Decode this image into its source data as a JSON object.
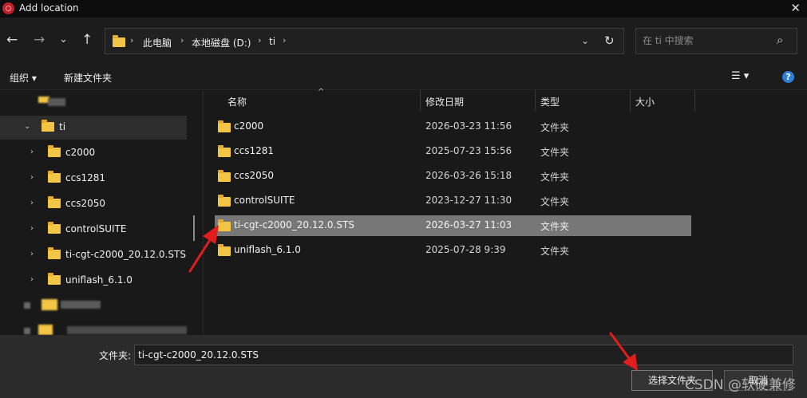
{
  "window": {
    "title": "Add location",
    "close_glyph": "✕"
  },
  "nav": {
    "back_glyph": "←",
    "forward_glyph": "→",
    "recent_glyph": "⌄",
    "up_glyph": "↑",
    "refresh_glyph": "↻"
  },
  "address": {
    "crumbs": [
      "此电脑",
      "本地磁盘 (D:)",
      "ti"
    ],
    "separator": "›"
  },
  "search": {
    "placeholder": "在 ti 中搜索",
    "icon_glyph": "⌕"
  },
  "toolbar": {
    "organize_label": "组织 ▾",
    "new_folder_label": "新建文件夹",
    "view_glyph": "☰ ▾",
    "help_glyph": "?"
  },
  "tree": {
    "root": {
      "label": "ti",
      "chevron": "⌄"
    },
    "children": [
      {
        "label": "c2000",
        "chevron": "›"
      },
      {
        "label": "ccs1281",
        "chevron": "›"
      },
      {
        "label": "ccs2050",
        "chevron": "›"
      },
      {
        "label": "controlSUITE",
        "chevron": "›"
      },
      {
        "label": "ti-cgt-c2000_20.12.0.STS",
        "chevron": "›"
      },
      {
        "label": "uniflash_6.1.0",
        "chevron": "›"
      }
    ]
  },
  "columns": {
    "name": "名称",
    "date": "修改日期",
    "type": "类型",
    "size": "大小",
    "sort_glyph": "^"
  },
  "files": [
    {
      "name": "c2000",
      "date": "2026-03-23 11:56",
      "type": "文件夹"
    },
    {
      "name": "ccs1281",
      "date": "2025-07-23 15:56",
      "type": "文件夹"
    },
    {
      "name": "ccs2050",
      "date": "2026-03-26 15:18",
      "type": "文件夹"
    },
    {
      "name": "controlSUITE",
      "date": "2023-12-27 11:30",
      "type": "文件夹"
    },
    {
      "name": "ti-cgt-c2000_20.12.0.STS",
      "date": "2026-03-27 11:03",
      "type": "文件夹"
    },
    {
      "name": "uniflash_6.1.0",
      "date": "2025-07-28 9:39",
      "type": "文件夹"
    }
  ],
  "selected_file_index": 4,
  "footer": {
    "filename_label": "文件夹:",
    "filename_value": "ti-cgt-c2000_20.12.0.STS",
    "select_button": "选择文件夹",
    "cancel_button": "取消"
  },
  "watermark": "CSDN @软硬兼修",
  "colors": {
    "background": "#191919",
    "selection": "#777777",
    "folder": "#f3c544",
    "annotation_arrow": "#e11d1d"
  }
}
